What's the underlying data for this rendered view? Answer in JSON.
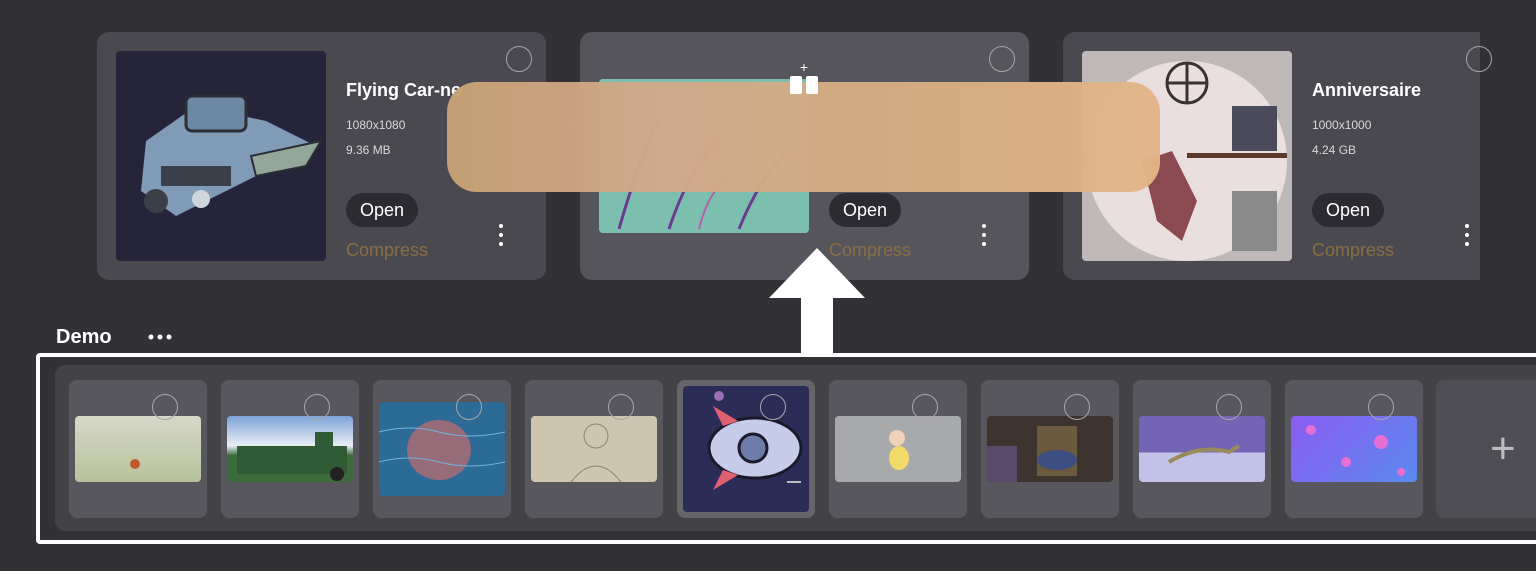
{
  "recent_projects": [
    {
      "title": "Flying Car-ne",
      "dimensions": "1080x1080",
      "size": "9.36 MB",
      "open_label": "Open",
      "compress_label": "Compress"
    },
    {
      "title": "",
      "dimensions": "",
      "size": "",
      "open_label": "Open",
      "compress_label": "Compress"
    },
    {
      "title": "Anniversaire",
      "dimensions": "1000x1000",
      "size": "4.24 GB",
      "open_label": "Open",
      "compress_label": "Compress"
    }
  ],
  "drag_icon_plus": "+",
  "section": {
    "title": "Demo"
  },
  "demo_thumbnails": [
    "bird-in-meadow",
    "green-train",
    "blue-water-sphere",
    "sketched-man",
    "rocket",
    "girl-character",
    "room-scene",
    "purple-lizard",
    "jellyfish"
  ],
  "add_tile_label": "+",
  "colors": {
    "background": "#323136",
    "card": "#4a494f",
    "compress_text": "#8a6f43",
    "drag_pill": "#d4ad82",
    "highlight": "#ffffff"
  }
}
